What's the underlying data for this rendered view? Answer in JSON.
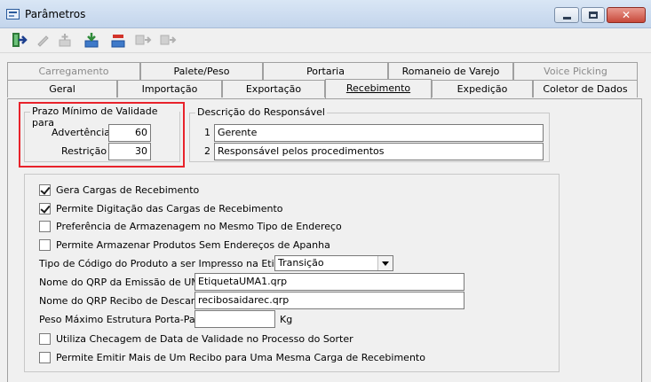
{
  "window": {
    "title": "Parâmetros"
  },
  "tabs": {
    "row1": [
      "Carregamento",
      "Palete/Peso",
      "Portaria",
      "Romaneio de Varejo",
      "Voice Picking"
    ],
    "row2": [
      "Geral",
      "Importação",
      "Exportação",
      "Recebimento",
      "Expedição",
      "Coletor de Dados"
    ]
  },
  "validade": {
    "legend": "Prazo Mínimo de Validade para",
    "advertencia_label": "Advertência",
    "advertencia_value": "60",
    "restricao_label": "Restrição",
    "restricao_value": "30"
  },
  "responsavel": {
    "legend": "Descrição do Responsável",
    "row1_num": "1",
    "row1_value": "Gerente",
    "row2_num": "2",
    "row2_value": "Responsável pelos procedimentos"
  },
  "options": {
    "gera_cargas": {
      "label": "Gera Cargas de Recebimento",
      "checked": true
    },
    "permite_digitacao": {
      "label": "Permite Digitação das Cargas de Recebimento",
      "checked": true
    },
    "preferencia": {
      "label": "Preferência de Armazenagem no Mesmo Tipo de Endereço",
      "checked": false
    },
    "permite_armazenar": {
      "label": "Permite Armazenar Produtos Sem Endereços de Apanha",
      "checked": false
    },
    "tipo_codigo_label": "Tipo de Código do Produto a ser Impresso na Etiqueta",
    "tipo_codigo_value": "Transição",
    "qrp_uma_label": "Nome do QRP da Emissão de UMA",
    "qrp_uma_value": "EtiquetaUMA1.qrp",
    "qrp_recibo_label": "Nome do QRP Recibo de Descarga",
    "qrp_recibo_value": "recibosaidarec.qrp",
    "peso_label": "Peso Máximo Estrutura Porta-Palete",
    "peso_value": "",
    "peso_unit": "Kg",
    "checagem": {
      "label": "Utiliza Checagem de Data de Validade no Processo do Sorter",
      "checked": false
    },
    "emitir_recibo": {
      "label": "Permite Emitir Mais de Um Recibo para Uma Mesma Carga de Recebimento",
      "checked": false
    }
  }
}
